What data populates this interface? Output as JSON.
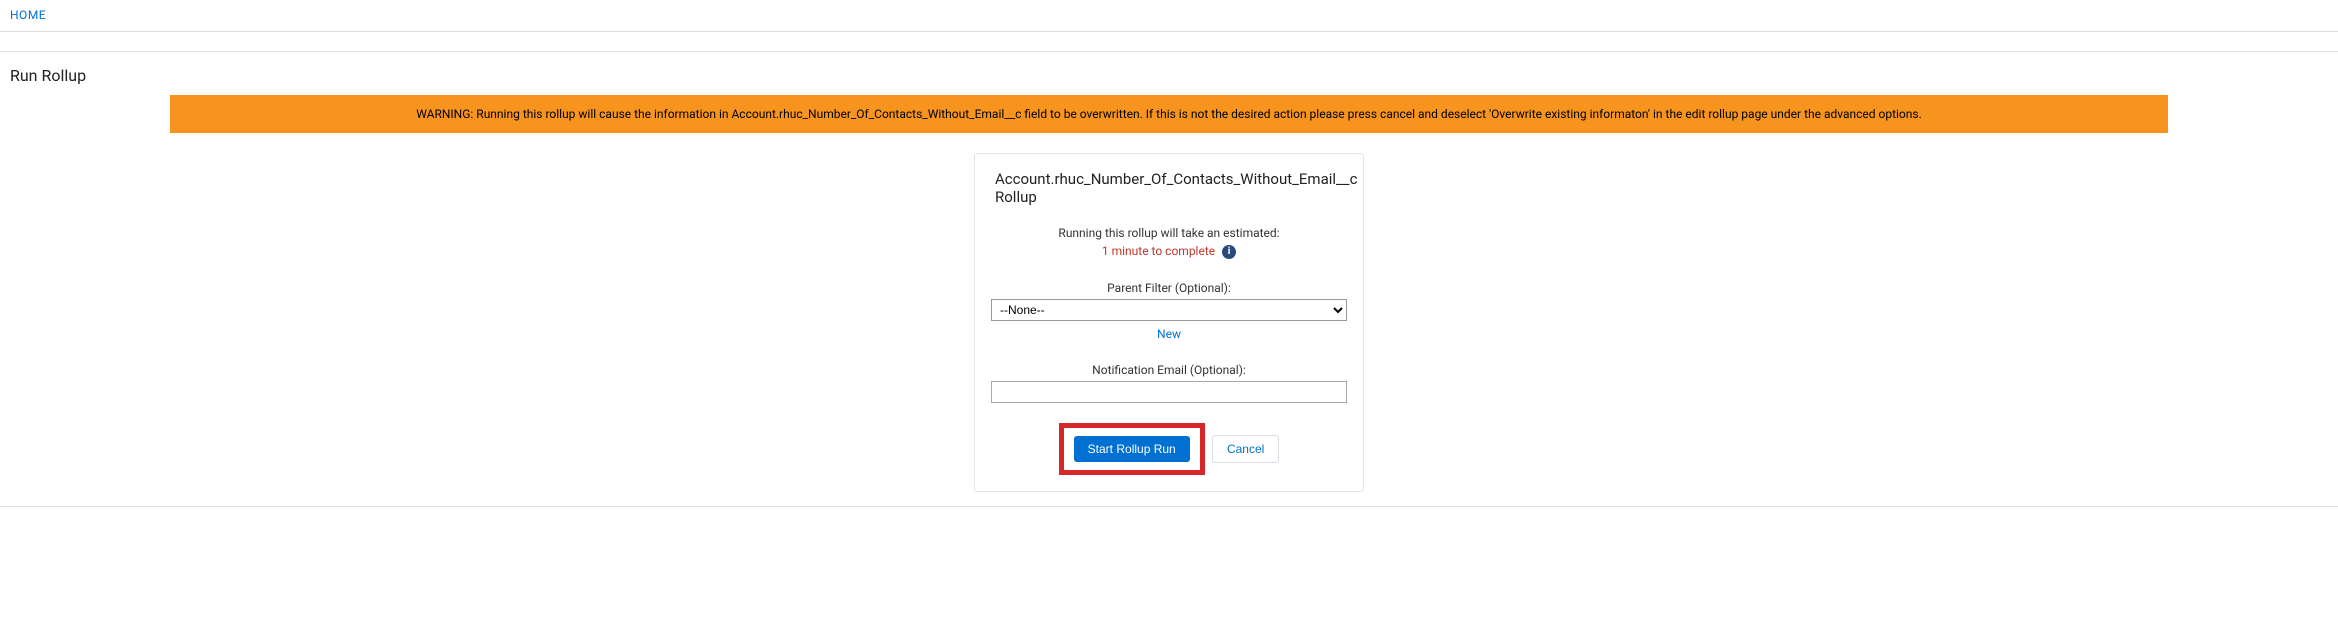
{
  "nav": {
    "home": "HOME"
  },
  "page": {
    "title": "Run Rollup"
  },
  "warning": {
    "text": "WARNING: Running this rollup will cause the information in Account.rhuc_Number_Of_Contacts_Without_Email__c field to be overwritten. If this is not the desired action please press cancel and deselect 'Overwrite existing informaton' in the edit rollup page under the advanced options."
  },
  "card": {
    "title": "Account.rhuc_Number_Of_Contacts_Without_Email__c Rollup",
    "estimate_intro": "Running this rollup will take an estimated:",
    "estimate_time": "1 minute to complete",
    "parent_filter_label": "Parent Filter (Optional):",
    "parent_filter_value": "--None--",
    "new_link": "New",
    "email_label": "Notification Email (Optional):",
    "email_value": "",
    "start_button": "Start Rollup Run",
    "cancel_button": "Cancel"
  }
}
